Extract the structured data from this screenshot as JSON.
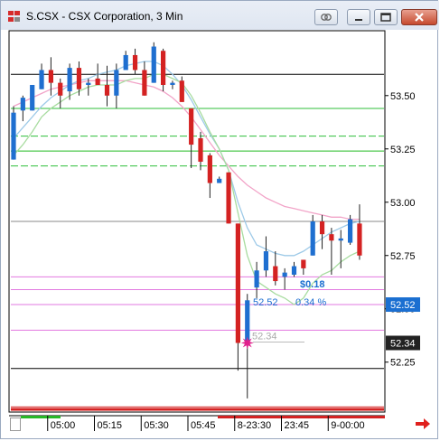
{
  "window": {
    "title": "S.CSX - CSX Corporation, 3 Min",
    "buttons": [
      "link-icon",
      "minimize-icon",
      "restore-icon",
      "close-icon"
    ]
  },
  "colors": {
    "up_candle": "#1f6fd0",
    "down_candle": "#d42222",
    "ma_fast": "#a8dca0",
    "ma_mid": "#9ecae8",
    "ma_slow": "#f2a4c8",
    "level_green": "#2fbf3a",
    "level_magenta": "#e27ae0",
    "marker": "#e0208c",
    "label_price_bg": "#1b6fd1",
    "label_dark_bg": "#222222"
  },
  "chart_data": {
    "type": "candlestick",
    "interval": "3 Min",
    "ylim": [
      52.02,
      53.8
    ],
    "ticks": [
      53.5,
      53.25,
      53.0,
      52.75,
      52.5,
      52.25
    ],
    "tick_labels": [
      "53.50",
      "53.25",
      "53.00",
      "52.75",
      "52.50",
      "52.25"
    ],
    "x_labels": [
      "05:00",
      "05:15",
      "05:30",
      "05:45",
      "8-23:30",
      "23:45",
      "9-00:00"
    ],
    "x_label_slots": [
      5,
      10,
      15,
      20,
      25,
      30,
      35
    ],
    "candles": [
      {
        "o": 53.2,
        "h": 53.45,
        "l": 53.2,
        "c": 53.42
      },
      {
        "o": 53.43,
        "h": 53.5,
        "l": 53.38,
        "c": 53.49
      },
      {
        "o": 53.43,
        "h": 53.55,
        "l": 53.43,
        "c": 53.55
      },
      {
        "o": 53.53,
        "h": 53.65,
        "l": 53.53,
        "c": 53.62
      },
      {
        "o": 53.62,
        "h": 53.68,
        "l": 53.5,
        "c": 53.56
      },
      {
        "o": 53.56,
        "h": 53.58,
        "l": 53.44,
        "c": 53.5
      },
      {
        "o": 53.52,
        "h": 53.65,
        "l": 53.48,
        "c": 53.63
      },
      {
        "o": 53.63,
        "h": 53.66,
        "l": 53.5,
        "c": 53.53
      },
      {
        "o": 53.55,
        "h": 53.58,
        "l": 53.5,
        "c": 53.56
      },
      {
        "o": 53.58,
        "h": 53.65,
        "l": 53.55,
        "c": 53.55
      },
      {
        "o": 53.55,
        "h": 53.64,
        "l": 53.45,
        "c": 53.5
      },
      {
        "o": 53.5,
        "h": 53.65,
        "l": 53.44,
        "c": 53.62
      },
      {
        "o": 53.62,
        "h": 53.71,
        "l": 53.62,
        "c": 53.69
      },
      {
        "o": 53.69,
        "h": 53.72,
        "l": 53.6,
        "c": 53.62
      },
      {
        "o": 53.62,
        "h": 53.66,
        "l": 53.5,
        "c": 53.5
      },
      {
        "o": 53.56,
        "h": 53.75,
        "l": 53.56,
        "c": 53.73
      },
      {
        "o": 53.71,
        "h": 53.72,
        "l": 53.52,
        "c": 53.55
      },
      {
        "o": 53.55,
        "h": 53.57,
        "l": 53.53,
        "c": 53.56
      },
      {
        "o": 53.57,
        "h": 53.59,
        "l": 53.47,
        "c": 53.47
      },
      {
        "o": 53.44,
        "h": 53.44,
        "l": 53.16,
        "c": 53.27
      },
      {
        "o": 53.3,
        "h": 53.33,
        "l": 53.15,
        "c": 53.19
      },
      {
        "o": 53.22,
        "h": 53.23,
        "l": 53.02,
        "c": 53.09
      },
      {
        "o": 53.09,
        "h": 53.12,
        "l": 53.09,
        "c": 53.11
      },
      {
        "o": 53.14,
        "h": 53.14,
        "l": 52.9,
        "c": 52.9
      },
      {
        "o": 52.9,
        "h": 52.9,
        "l": 52.21,
        "c": 52.34
      },
      {
        "o": 52.34,
        "h": 52.57,
        "l": 52.08,
        "c": 52.54
      },
      {
        "o": 52.6,
        "h": 52.72,
        "l": 52.55,
        "c": 52.68
      },
      {
        "o": 52.68,
        "h": 52.84,
        "l": 52.65,
        "c": 52.77
      },
      {
        "o": 52.7,
        "h": 52.77,
        "l": 52.61,
        "c": 52.63
      },
      {
        "o": 52.65,
        "h": 52.69,
        "l": 52.59,
        "c": 52.67
      },
      {
        "o": 52.66,
        "h": 52.72,
        "l": 52.65,
        "c": 52.7
      },
      {
        "o": 52.73,
        "h": 52.73,
        "l": 52.66,
        "c": 52.69
      },
      {
        "o": 52.75,
        "h": 52.94,
        "l": 52.75,
        "c": 52.91
      },
      {
        "o": 52.91,
        "h": 52.94,
        "l": 52.78,
        "c": 52.85
      },
      {
        "o": 52.85,
        "h": 52.88,
        "l": 52.66,
        "c": 52.82
      },
      {
        "o": 52.82,
        "h": 52.87,
        "l": 52.69,
        "c": 52.83
      },
      {
        "o": 52.81,
        "h": 52.94,
        "l": 52.8,
        "c": 52.92
      },
      {
        "o": 52.9,
        "h": 52.99,
        "l": 52.73,
        "c": 52.75
      }
    ],
    "ma_fast": [
      53.22,
      53.27,
      53.33,
      53.4,
      53.44,
      53.47,
      53.5,
      53.52,
      53.54,
      53.55,
      53.55,
      53.55,
      53.57,
      53.58,
      53.58,
      53.6,
      53.6,
      53.58,
      53.56,
      53.5,
      53.42,
      53.33,
      53.25,
      53.15,
      52.95,
      52.75,
      52.63,
      52.6,
      52.57,
      52.55,
      52.52,
      52.55,
      52.62,
      52.66,
      52.68,
      52.72,
      52.75,
      52.77
    ],
    "ma_mid": [
      53.3,
      53.35,
      53.4,
      53.45,
      53.49,
      53.52,
      53.55,
      53.57,
      53.58,
      53.6,
      53.61,
      53.62,
      53.64,
      53.65,
      53.66,
      53.66,
      53.64,
      53.6,
      53.55,
      53.48,
      53.4,
      53.32,
      53.25,
      53.15,
      53.0,
      52.88,
      52.8,
      52.78,
      52.76,
      52.75,
      52.75,
      52.77,
      52.8,
      52.83,
      52.86,
      52.88,
      52.9,
      52.91
    ],
    "ma_slow": [
      53.45,
      53.47,
      53.49,
      53.51,
      53.53,
      53.54,
      53.55,
      53.56,
      53.57,
      53.57,
      53.57,
      53.57,
      53.57,
      53.56,
      53.55,
      53.54,
      53.52,
      53.49,
      53.45,
      53.4,
      53.34,
      53.28,
      53.22,
      53.17,
      53.12,
      53.08,
      53.05,
      53.02,
      53.0,
      52.98,
      52.97,
      52.96,
      52.95,
      52.94,
      52.93,
      52.93,
      52.92,
      52.92
    ],
    "levels": [
      {
        "y": 53.6,
        "color": "#000000",
        "dash": "solid"
      },
      {
        "y": 53.44,
        "color": "#2fbf3a",
        "dash": "solid"
      },
      {
        "y": 53.31,
        "color": "#2fbf3a",
        "dash": "dash"
      },
      {
        "y": 53.24,
        "color": "#22bb22",
        "dash": "solid"
      },
      {
        "y": 53.17,
        "color": "#2fbf3a",
        "dash": "dash"
      },
      {
        "y": 52.91,
        "color": "#888888",
        "dash": "solid"
      },
      {
        "y": 52.65,
        "color": "#e27ae0",
        "dash": "solid"
      },
      {
        "y": 52.59,
        "color": "#e27ae0",
        "dash": "solid"
      },
      {
        "y": 52.52,
        "color": "#e27ae0",
        "dash": "solid"
      },
      {
        "y": 52.4,
        "color": "#e27ae0",
        "dash": "solid"
      },
      {
        "y": 52.22,
        "color": "#000000",
        "dash": "solid"
      },
      {
        "y": 52.04,
        "color": "#d42222",
        "dash": "solid"
      }
    ],
    "entry_marker": {
      "slot": 25,
      "price": 52.34,
      "label": "52.34"
    },
    "annotations": {
      "change_dollar": "$0.18",
      "last_label": "52.52",
      "change_pct": "0.34 %"
    },
    "price_labels": [
      {
        "value": "52.52",
        "price": 52.52,
        "style": "blue"
      },
      {
        "value": "52.34",
        "price": 52.34,
        "style": "dark"
      }
    ]
  }
}
